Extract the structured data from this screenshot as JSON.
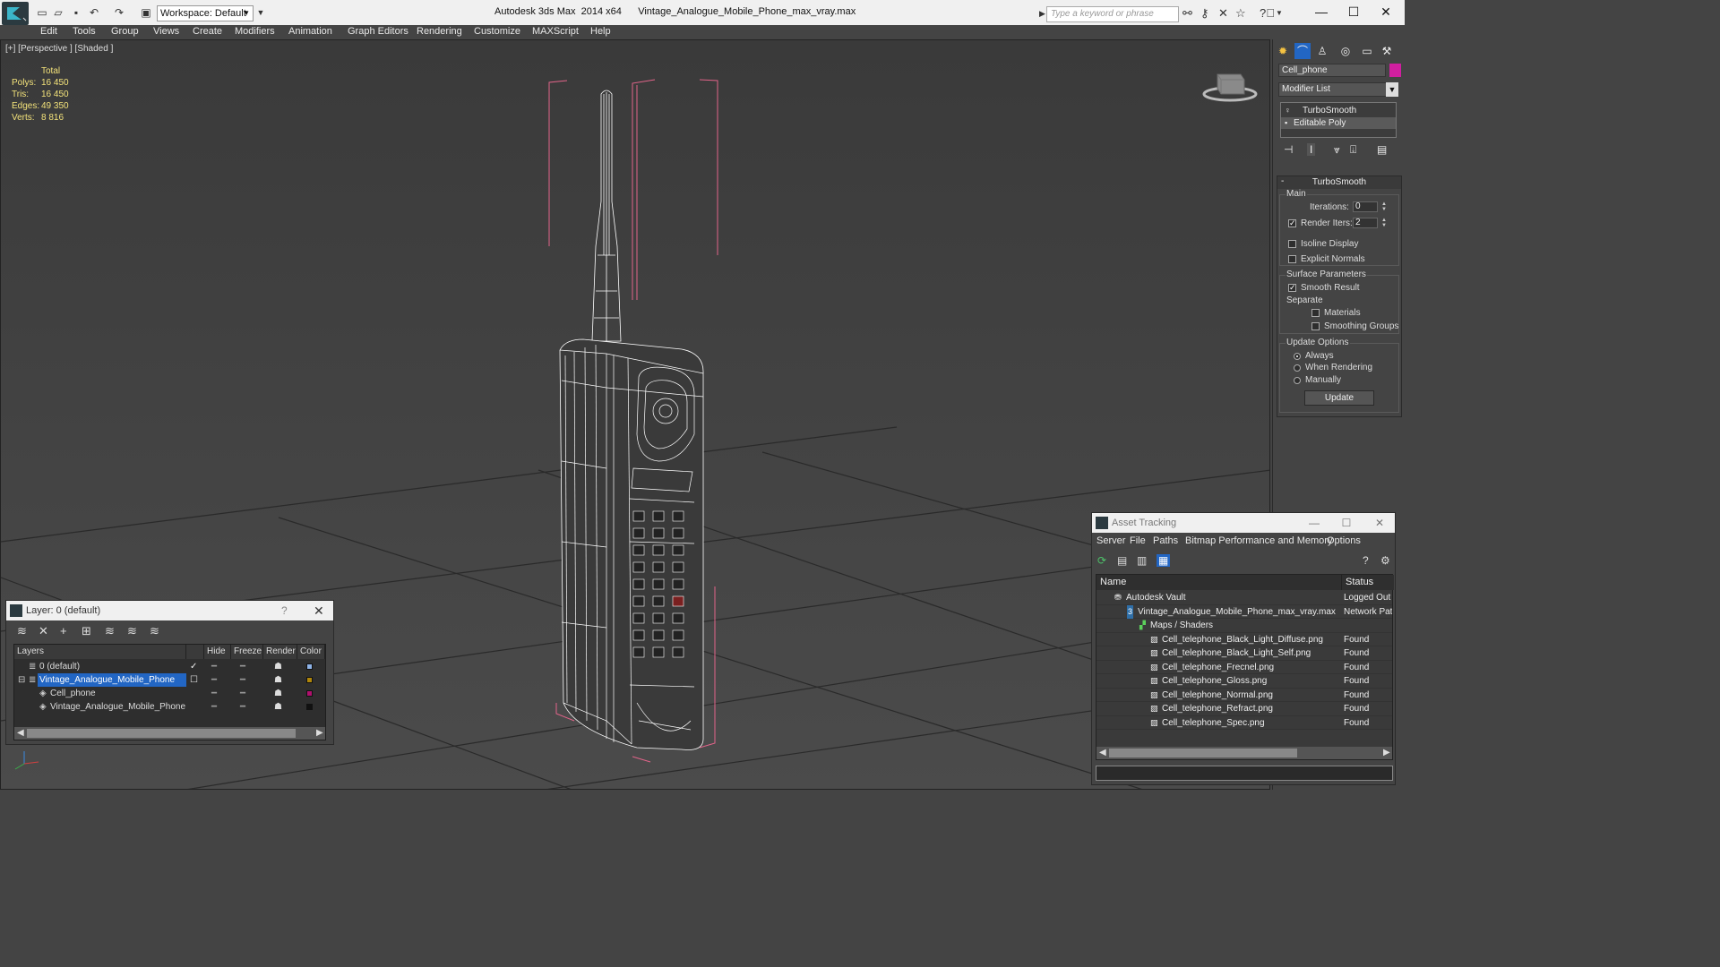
{
  "titlebar": {
    "app_title": "Autodesk 3ds Max  2014 x64",
    "file_name": "Vintage_Analogue_Mobile_Phone_max_vray.max",
    "workspace_label": "Workspace: Default",
    "search_placeholder": "Type a keyword or phrase"
  },
  "menubar": {
    "items": [
      "Edit",
      "Tools",
      "Group",
      "Views",
      "Create",
      "Modifiers",
      "Animation",
      "Graph Editors",
      "Rendering",
      "Customize",
      "MAXScript",
      "Help"
    ]
  },
  "viewport": {
    "label": "[+] [Perspective ] [Shaded ]",
    "stats": {
      "header": "Total",
      "rows": [
        {
          "label": "Polys:",
          "value": "16 450"
        },
        {
          "label": "Tris:",
          "value": "16 450"
        },
        {
          "label": "Edges:",
          "value": "49 350"
        },
        {
          "label": "Verts:",
          "value": "8 816"
        }
      ]
    }
  },
  "command_panel": {
    "object_name": "Cell_phone",
    "object_color": "#d01fa0",
    "modifier_list_label": "Modifier List",
    "stack": [
      "TurboSmooth",
      "Editable Poly"
    ],
    "turbosmooth": {
      "title": "TurboSmooth",
      "main_label": "Main",
      "iterations_label": "Iterations:",
      "iterations_value": "0",
      "render_iters_label": "Render Iters:",
      "render_iters_value": "2",
      "render_iters_checked": true,
      "isoline_label": "Isoline Display",
      "explicit_normals_label": "Explicit Normals",
      "surface_params_label": "Surface Parameters",
      "smooth_result_label": "Smooth Result",
      "separate_label": "Separate",
      "materials_label": "Materials",
      "smoothing_groups_label": "Smoothing Groups",
      "update_options_label": "Update Options",
      "always_label": "Always",
      "when_rendering_label": "When Rendering",
      "manually_label": "Manually",
      "update_button": "Update"
    }
  },
  "layer_dialog": {
    "title": "Layer: 0 (default)",
    "help": "?",
    "columns": [
      "Layers",
      "Hide",
      "Freeze",
      "Render",
      "Color"
    ],
    "rows": [
      {
        "name": "0 (default)",
        "color": "#8fb4e8",
        "indent": 1
      },
      {
        "name": "Vintage_Analogue_Mobile_Phone",
        "color": "#b0860a",
        "indent": 1,
        "selected": true
      },
      {
        "name": "Cell_phone",
        "color": "#b0106e",
        "indent": 2
      },
      {
        "name": "Vintage_Analogue_Mobile_Phone",
        "color": "#111111",
        "indent": 2
      }
    ]
  },
  "asset_tracking": {
    "title": "Asset Tracking",
    "menu": [
      "Server",
      "File",
      "Paths",
      "Bitmap Performance and Memory",
      "Options"
    ],
    "columns": [
      "Name",
      "Status"
    ],
    "rows": [
      {
        "name": "Autodesk Vault",
        "status": "Logged Out"
      },
      {
        "name": "Vintage_Analogue_Mobile_Phone_max_vray.max",
        "status": "Network Path"
      },
      {
        "name": "Maps / Shaders",
        "status": ""
      },
      {
        "name": "Cell_telephone_Black_Light_Diffuse.png",
        "status": "Found"
      },
      {
        "name": "Cell_telephone_Black_Light_Self.png",
        "status": "Found"
      },
      {
        "name": "Cell_telephone_Frecnel.png",
        "status": "Found"
      },
      {
        "name": "Cell_telephone_Gloss.png",
        "status": "Found"
      },
      {
        "name": "Cell_telephone_Normal.png",
        "status": "Found"
      },
      {
        "name": "Cell_telephone_Refract.png",
        "status": "Found"
      },
      {
        "name": "Cell_telephone_Spec.png",
        "status": "Found"
      }
    ]
  }
}
